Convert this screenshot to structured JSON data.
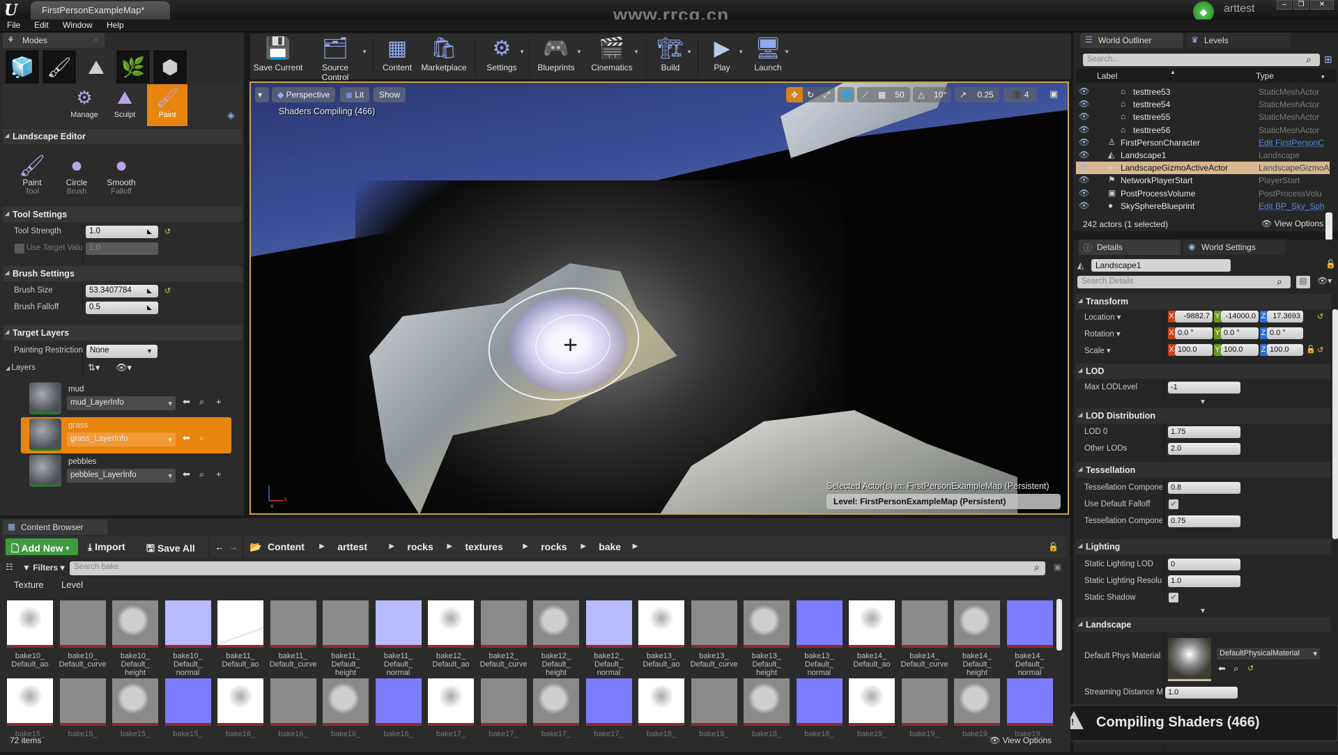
{
  "window": {
    "app_logo": "U",
    "document_tab": "FirstPersonExampleMap*",
    "watermark": "www.rrcg.cn",
    "user": "arttest",
    "controls": {
      "minimize": "–",
      "maximize": "❐",
      "close": "✕"
    }
  },
  "menu": [
    "File",
    "Edit",
    "Window",
    "Help"
  ],
  "modes": {
    "tab_label": "Modes",
    "mode_icons": [
      {
        "name": "place-mode",
        "glyph": "🧊"
      },
      {
        "name": "paint-mode",
        "glyph": "🖌"
      },
      {
        "name": "landscape-mode",
        "glyph": "⛰"
      },
      {
        "name": "foliage-mode",
        "glyph": "🌿"
      },
      {
        "name": "geometry-mode",
        "glyph": "⬢"
      }
    ],
    "sub_modes": [
      {
        "label": "Manage",
        "glyph": "⚙",
        "active": false
      },
      {
        "label": "Sculpt",
        "glyph": "⛰",
        "active": false
      },
      {
        "label": "Paint",
        "glyph": "🖌",
        "active": true
      }
    ],
    "landscape_editor": {
      "title": "Landscape Editor",
      "tools": [
        {
          "label": "Paint",
          "sub": "Tool",
          "glyph": "🖌"
        },
        {
          "label": "Circle",
          "sub": "Brush",
          "glyph": "●"
        },
        {
          "label": "Smooth",
          "sub": "Falloff",
          "glyph": "●"
        }
      ]
    },
    "tool_settings": {
      "title": "Tool Settings",
      "tool_strength_label": "Tool Strength",
      "tool_strength": "1.0",
      "use_target_value_label": "Use Target Valu",
      "use_target_value": "1.0",
      "use_target_value_checked": false
    },
    "brush_settings": {
      "title": "Brush Settings",
      "brush_size_label": "Brush Size",
      "brush_size": "53.3407784",
      "brush_falloff_label": "Brush Falloff",
      "brush_falloff": "0.5"
    },
    "target_layers": {
      "title": "Target Layers",
      "painting_restriction_label": "Painting Restriction",
      "painting_restriction": "None",
      "layers_label": "Layers",
      "layers": [
        {
          "name": "mud",
          "info": "mud_LayerInfo",
          "active": false
        },
        {
          "name": "grass",
          "info": "grass_LayerInfo",
          "active": true
        },
        {
          "name": "pebbles",
          "info": "pebbles_LayerInfo",
          "active": false
        }
      ]
    }
  },
  "toolbar": {
    "buttons": [
      {
        "label": "Save Current",
        "glyph": "💾",
        "dropdown": false
      },
      {
        "label": "Source Control",
        "glyph": "🗂",
        "dropdown": true
      },
      {
        "label": "Content",
        "glyph": "▦",
        "dropdown": false
      },
      {
        "label": "Marketplace",
        "glyph": "🛍",
        "dropdown": false
      },
      {
        "label": "Settings",
        "glyph": "⚙",
        "dropdown": true
      },
      {
        "label": "Blueprints",
        "glyph": "🎮",
        "dropdown": true
      },
      {
        "label": "Cinematics",
        "glyph": "🎬",
        "dropdown": true
      },
      {
        "label": "Build",
        "glyph": "🏗",
        "dropdown": true
      },
      {
        "label": "Play",
        "glyph": "▶",
        "dropdown": true
      },
      {
        "label": "Launch",
        "glyph": "🖥",
        "dropdown": true
      }
    ]
  },
  "viewport": {
    "perspective": "Perspective",
    "lit": "Lit",
    "show": "Show",
    "shaders_compiling": "Shaders Compiling (466)",
    "grid_snap": "50",
    "rotation_snap": "10°",
    "scale_snap": "0.25",
    "camera_speed": "4",
    "selected_actors": "Selected Actor(s) in:  FirstPersonExampleMap (Persistent)",
    "level": "Level:  FirstPersonExampleMap (Persistent)"
  },
  "outliner": {
    "tab_label": "World Outliner",
    "levels_tab": "Levels",
    "search_placeholder": "Search...",
    "col_label": "Label",
    "col_type": "Type",
    "rows": [
      {
        "label": "testtree53",
        "type": "StaticMeshActor",
        "indent": 2,
        "icon": "⌂",
        "link": false,
        "selected": false
      },
      {
        "label": "testtree54",
        "type": "StaticMeshActor",
        "indent": 2,
        "icon": "⌂",
        "link": false,
        "selected": false
      },
      {
        "label": "testtree55",
        "type": "StaticMeshActor",
        "indent": 2,
        "icon": "⌂",
        "link": false,
        "selected": false
      },
      {
        "label": "testtree56",
        "type": "StaticMeshActor",
        "indent": 2,
        "icon": "⌂",
        "link": false,
        "selected": false
      },
      {
        "label": "FirstPersonCharacter",
        "type": "Edit FirstPersonC",
        "indent": 1,
        "icon": "♙",
        "link": true,
        "selected": false
      },
      {
        "label": "Landscape1",
        "type": "Landscape",
        "indent": 1,
        "icon": "◭",
        "link": false,
        "selected": false
      },
      {
        "label": "LandscapeGizmoActiveActor",
        "type": "LandscapeGizmoA",
        "indent": 1,
        "icon": "●",
        "link": false,
        "selected": true
      },
      {
        "label": "NetworkPlayerStart",
        "type": "PlayerStart",
        "indent": 1,
        "icon": "⚑",
        "link": false,
        "selected": false
      },
      {
        "label": "PostProcessVolume",
        "type": "PostProcessVolu",
        "indent": 1,
        "icon": "▣",
        "link": false,
        "selected": false
      },
      {
        "label": "SkySphereBlueprint",
        "type": "Edit BP_Sky_Sph",
        "indent": 1,
        "icon": "●",
        "link": true,
        "selected": false
      }
    ],
    "footer": "242 actors (1 selected)",
    "view_options": "View Options"
  },
  "details": {
    "tab_label": "Details",
    "world_settings_tab": "World Settings",
    "object_name": "Landscape1",
    "search_placeholder": "Search Details",
    "transform": {
      "title": "Transform",
      "location_label": "Location",
      "location": {
        "x": "-9882.7",
        "y": "-14000.0",
        "z": "17.3693"
      },
      "rotation_label": "Rotation",
      "rotation": {
        "x": "0.0 °",
        "y": "0.0 °",
        "z": "0.0 °"
      },
      "scale_label": "Scale",
      "scale": {
        "x": "100.0",
        "y": "100.0",
        "z": "100.0"
      }
    },
    "lod": {
      "title": "LOD",
      "max_lod_label": "Max LODLevel",
      "max_lod": "-1"
    },
    "lod_distribution": {
      "title": "LOD Distribution",
      "lod0_label": "LOD 0",
      "lod0": "1.75",
      "other_label": "Other LODs",
      "other": "2.0"
    },
    "tessellation": {
      "title": "Tessellation",
      "comp1_label": "Tessellation Compone",
      "comp1": "0.8",
      "default_falloff_label": "Use Default Falloff",
      "default_falloff": true,
      "comp2_label": "Tessellation Compone",
      "comp2": "0.75"
    },
    "lighting": {
      "title": "Lighting",
      "lod_label": "Static Lighting LOD",
      "lod": "0",
      "res_label": "Static Lighting Resolu",
      "res": "1.0",
      "shadow_label": "Static Shadow",
      "shadow": true
    },
    "landscape": {
      "title": "Landscape",
      "phys_label": "Default Phys Material",
      "phys": "DefaultPhysicalMaterial",
      "stream_label": "Streaming Distance M",
      "stream": "1.0"
    }
  },
  "toast": {
    "text": "Compiling Shaders (466)",
    "icon": "!"
  },
  "content_browser": {
    "tab_label": "Content Browser",
    "add_new": "Add New",
    "import": "Import",
    "save_all": "Save All",
    "breadcrumbs": [
      "Content",
      "arttest",
      "rocks",
      "textures",
      "rocks",
      "bake"
    ],
    "filters": "Filters",
    "search_placeholder": "Search bake",
    "filter_chips": [
      "Texture",
      "Level"
    ],
    "assets_row1": [
      {
        "name": "bake10_\nDefault_ao",
        "kind": "ao"
      },
      {
        "name": "bake10_\nDefault_curve",
        "kind": "curve"
      },
      {
        "name": "bake10_\nDefault_\nheight",
        "kind": "height"
      },
      {
        "name": "bake10_\nDefault_\nnormal",
        "kind": "normal-light"
      },
      {
        "name": "bake11_\nDefault_ao",
        "kind": "white"
      },
      {
        "name": "bake11_\nDefault_curve",
        "kind": "curve"
      },
      {
        "name": "bake11_\nDefault_\nheight",
        "kind": "curve"
      },
      {
        "name": "bake11_\nDefault_\nnormal",
        "kind": "normal-light"
      },
      {
        "name": "bake12_\nDefault_ao",
        "kind": "ao"
      },
      {
        "name": "bake12_\nDefault_curve",
        "kind": "curve"
      },
      {
        "name": "bake12_\nDefault_\nheight",
        "kind": "height"
      },
      {
        "name": "bake12_\nDefault_\nnormal",
        "kind": "normal-light"
      },
      {
        "name": "bake13_\nDefault_ao",
        "kind": "ao"
      },
      {
        "name": "bake13_\nDefault_curve",
        "kind": "curve"
      },
      {
        "name": "bake13_\nDefault_\nheight",
        "kind": "height"
      },
      {
        "name": "bake13_\nDefault_\nnormal",
        "kind": "normal"
      },
      {
        "name": "bake14_\nDefault_ao",
        "kind": "ao"
      },
      {
        "name": "bake14_\nDefault_curve",
        "kind": "curve"
      },
      {
        "name": "bake14_\nDefault_\nheight",
        "kind": "height"
      },
      {
        "name": "bake14_\nDefault_\nnormal",
        "kind": "normal"
      }
    ],
    "assets_row2": [
      {
        "name": "bake15_",
        "kind": "ao"
      },
      {
        "name": "bake15_",
        "kind": "curve"
      },
      {
        "name": "bake15_",
        "kind": "height"
      },
      {
        "name": "bake15_",
        "kind": "normal"
      },
      {
        "name": "bake16_",
        "kind": "ao"
      },
      {
        "name": "bake16_",
        "kind": "curve"
      },
      {
        "name": "bake16_",
        "kind": "height"
      },
      {
        "name": "bake16_",
        "kind": "normal"
      },
      {
        "name": "bake17_",
        "kind": "ao"
      },
      {
        "name": "bake17_",
        "kind": "curve"
      },
      {
        "name": "bake17_",
        "kind": "height"
      },
      {
        "name": "bake17_",
        "kind": "normal"
      },
      {
        "name": "bake18_",
        "kind": "ao"
      },
      {
        "name": "bake18_",
        "kind": "curve"
      },
      {
        "name": "bake18_",
        "kind": "height"
      },
      {
        "name": "bake18_",
        "kind": "normal"
      },
      {
        "name": "bake19_",
        "kind": "ao"
      },
      {
        "name": "bake19_",
        "kind": "curve"
      },
      {
        "name": "bake19_",
        "kind": "height"
      },
      {
        "name": "bake19_",
        "kind": "normal"
      }
    ],
    "item_count": "72 items",
    "view_options": "View Options"
  },
  "colors": {
    "accent_orange": "#e8850e",
    "selection": "#d9b891",
    "add_new_green": "#3f9a3f",
    "viewport_border": "#c8a64a",
    "link_blue": "#5a86d9"
  }
}
